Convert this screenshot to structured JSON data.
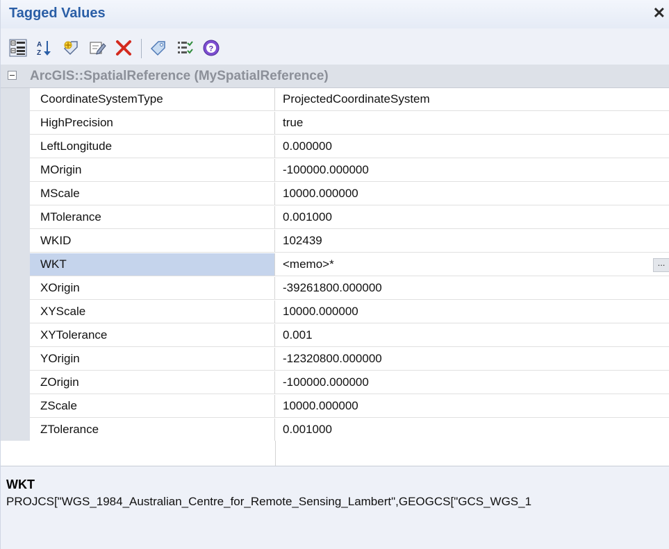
{
  "window": {
    "title": "Tagged Values",
    "close_glyph": "✕"
  },
  "toolbar": {
    "buttons": [
      {
        "icon": "categorized-view-icon",
        "label": "Categorized"
      },
      {
        "icon": "sort-alphabetical-icon",
        "label": "Alphabetical"
      },
      {
        "icon": "new-tag-icon",
        "label": "New Tag"
      },
      {
        "icon": "edit-note-icon",
        "label": "Edit"
      },
      {
        "icon": "delete-icon",
        "label": "Delete"
      },
      {
        "icon": "tag-icon",
        "label": "Tags"
      },
      {
        "icon": "filter-icon",
        "label": "Filter"
      },
      {
        "icon": "help-icon",
        "label": "Help"
      }
    ]
  },
  "group": {
    "label": "ArcGIS::SpatialReference (MySpatialReference)",
    "expanded": true
  },
  "rows": [
    {
      "name": "CoordinateSystemType",
      "value": "ProjectedCoordinateSystem"
    },
    {
      "name": "HighPrecision",
      "value": "true"
    },
    {
      "name": "LeftLongitude",
      "value": "0.000000"
    },
    {
      "name": "MOrigin",
      "value": "-100000.000000"
    },
    {
      "name": "MScale",
      "value": "10000.000000"
    },
    {
      "name": "MTolerance",
      "value": "0.001000"
    },
    {
      "name": "WKID",
      "value": "102439"
    },
    {
      "name": "WKT",
      "value": "<memo>*",
      "selected": true,
      "has_button": true,
      "button_label": "..."
    },
    {
      "name": "XOrigin",
      "value": "-39261800.000000"
    },
    {
      "name": "XYScale",
      "value": "10000.000000"
    },
    {
      "name": "XYTolerance",
      "value": "0.001"
    },
    {
      "name": "YOrigin",
      "value": "-12320800.000000"
    },
    {
      "name": "ZOrigin",
      "value": "-100000.000000"
    },
    {
      "name": "ZScale",
      "value": "10000.000000"
    },
    {
      "name": "ZTolerance",
      "value": "0.001000"
    }
  ],
  "description": {
    "title": "WKT",
    "text": "PROJCS[\"WGS_1984_Australian_Centre_for_Remote_Sensing_Lambert\",GEOGCS[\"GCS_WGS_1"
  },
  "colors": {
    "accent": "#2a5ea6",
    "selected_row": "#c5d4ec",
    "group_bg": "#dde1e8"
  }
}
